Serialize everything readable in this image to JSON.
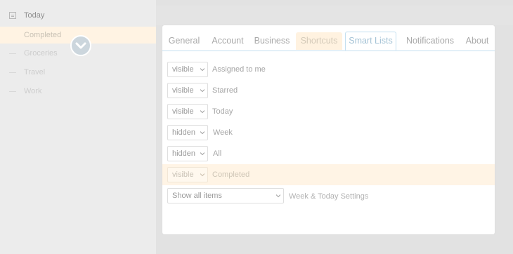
{
  "sidebar": {
    "items": [
      {
        "label": "Today"
      },
      {
        "label": "Completed"
      },
      {
        "label": "Groceries"
      },
      {
        "label": "Travel"
      },
      {
        "label": "Work"
      }
    ]
  },
  "preferences": {
    "tabs": [
      {
        "label": "General"
      },
      {
        "label": "Account"
      },
      {
        "label": "Business"
      },
      {
        "label": "Shortcuts"
      },
      {
        "label": "Smart Lists"
      },
      {
        "label": "Notifications"
      },
      {
        "label": "About"
      }
    ],
    "active_tab": "Smart Lists",
    "smart_lists": [
      {
        "visibility": "visible",
        "name": "Assigned to me"
      },
      {
        "visibility": "visible",
        "name": "Starred"
      },
      {
        "visibility": "visible",
        "name": "Today"
      },
      {
        "visibility": "hidden",
        "name": "Week"
      },
      {
        "visibility": "hidden",
        "name": "All"
      },
      {
        "visibility": "visible",
        "name": "Completed"
      }
    ],
    "week_today": {
      "value": "Show all items",
      "label": "Week & Today Settings"
    }
  },
  "colors": {
    "highlight": "#fff4e5",
    "tab_border": "#c4dff0",
    "badge": "#ccd6dd"
  },
  "icons": {
    "check": "check-badge-icon",
    "dropdown": "chevron-down-icon",
    "list": "list-icon"
  }
}
